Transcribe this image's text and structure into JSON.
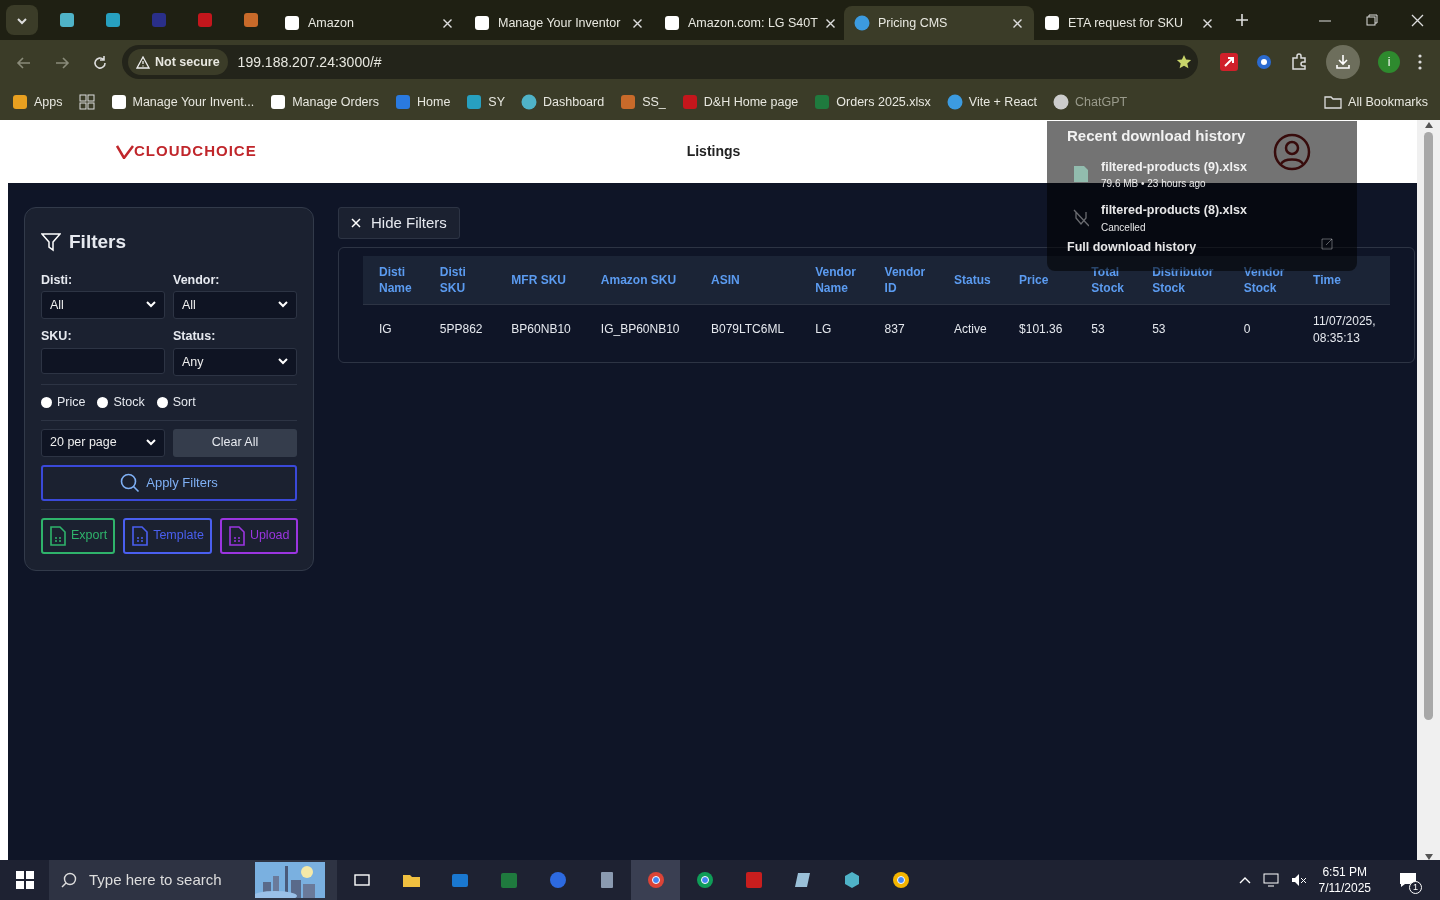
{
  "browser": {
    "tabs": [
      {
        "title": "Amazon",
        "selected": false
      },
      {
        "title": "Manage Your Inventor",
        "selected": false
      },
      {
        "title": "Amazon.com: LG S40T",
        "selected": false
      },
      {
        "title": "Pricing CMS",
        "selected": true
      },
      {
        "title": "ETA request for SKU",
        "selected": false
      }
    ],
    "security": "Not secure",
    "url": "199.188.207.24:3000/#",
    "bookmarks": [
      "Apps",
      "Manage Your Invent...",
      "Manage Orders",
      "Home",
      "SY",
      "Dashboard",
      "SS_",
      "D&H Home page",
      "Orders 2025.xlsx",
      "Vite + React",
      "ChatGPT"
    ],
    "all_bookmarks": "All Bookmarks",
    "profile_initial": "i"
  },
  "download_panel": {
    "title": "Recent download history",
    "items": [
      {
        "name": "filtered-products (9).xlsx",
        "detail": "79.6 MB • 23 hours ago",
        "kind": "done"
      },
      {
        "name": "filtered-products (8).xlsx",
        "detail": "Cancelled",
        "kind": "cancelled"
      }
    ],
    "footer": "Full download history"
  },
  "header": {
    "logo": "CLOUDCHOICE",
    "nav": "Listings"
  },
  "filters": {
    "title": "Filters",
    "fields": [
      {
        "label": "Disti:",
        "kind": "select",
        "value": "All"
      },
      {
        "label": "Vendor:",
        "kind": "select",
        "value": "All"
      },
      {
        "label": "SKU:",
        "kind": "input"
      },
      {
        "label": "Status:",
        "kind": "select",
        "value": "Any"
      }
    ],
    "radios": [
      {
        "label": "Price",
        "selected": false
      },
      {
        "label": "Stock",
        "selected": false
      },
      {
        "label": "Sort",
        "selected": false
      }
    ],
    "per_page": "20 per page",
    "clear": "Clear All",
    "apply": "Apply Filters",
    "actions": [
      {
        "label": "Export",
        "color": "#2fb36b"
      },
      {
        "label": "Template",
        "color": "#4a5ff0"
      },
      {
        "label": "Upload",
        "color": "#9b35e0"
      }
    ]
  },
  "hide_filters": "Hide Filters",
  "table": {
    "columns": [
      "Disti Name",
      "Disti SKU",
      "MFR SKU",
      "Amazon SKU",
      "ASIN",
      "Vendor Name",
      "Vendor ID",
      "Status",
      "Price",
      "Total Stock",
      "Distributor Stock",
      "Vendor Stock",
      "Time"
    ],
    "rows": [
      [
        "IG",
        "5PP862",
        "BP60NB10",
        "IG_BP60NB10",
        "B079LTC6ML",
        "LG",
        "837",
        "Active",
        "$101.36",
        "53",
        "53",
        "0",
        "11/07/2025, 08:35:13"
      ]
    ]
  },
  "taskbar": {
    "search_placeholder": "Type here to search",
    "time": "6:51 PM",
    "date": "7/11/2025",
    "notifications": "1"
  }
}
